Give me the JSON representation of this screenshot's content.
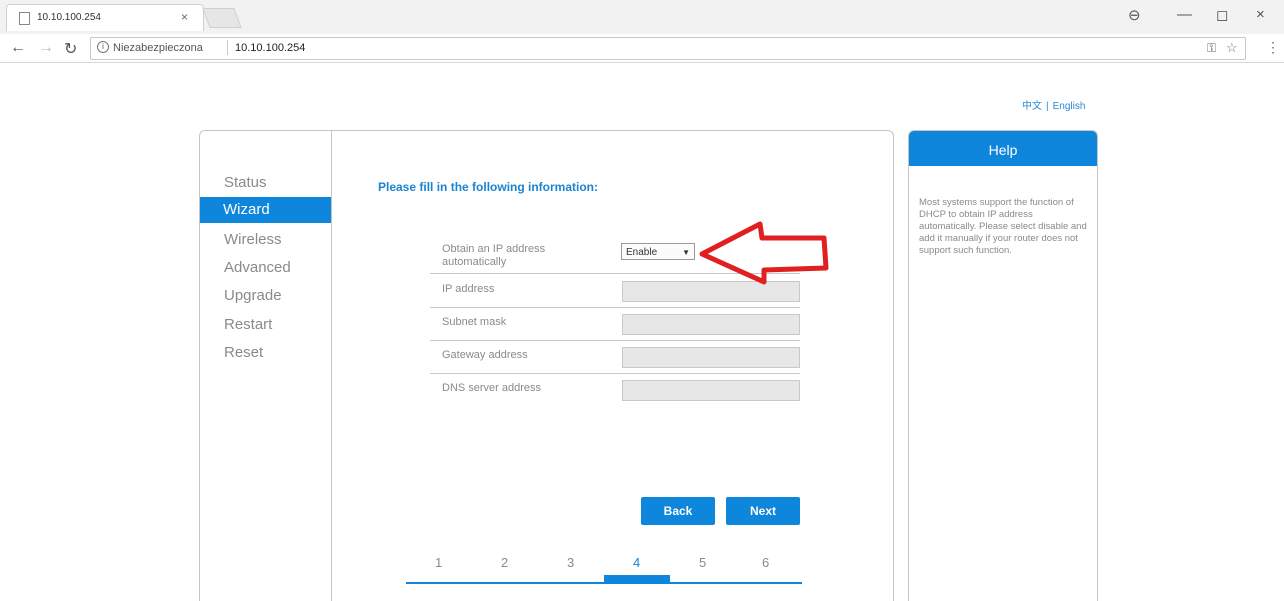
{
  "browser": {
    "tab_title": "10.10.100.254",
    "tab_close": "×",
    "security_label": "Niezabezpieczona",
    "url": "10.10.100.254",
    "window_controls": {
      "account": "⊖",
      "minimize": "—",
      "restore": "◻",
      "close": "×"
    }
  },
  "lang": {
    "chinese": "中文",
    "separator": "|",
    "english": "English"
  },
  "sidebar": {
    "items": [
      {
        "label": "Status"
      },
      {
        "label": "Wizard",
        "active": true
      },
      {
        "label": "Wireless"
      },
      {
        "label": "Advanced"
      },
      {
        "label": "Upgrade"
      },
      {
        "label": "Restart"
      },
      {
        "label": "Reset"
      }
    ]
  },
  "form": {
    "heading": "Please fill in the following information:",
    "obtain_ip_label": "Obtain an IP address automatically",
    "obtain_ip_value": "Enable",
    "ip_address_label": "IP address",
    "subnet_mask_label": "Subnet mask",
    "gateway_label": "Gateway address",
    "dns_label": "DNS server address",
    "back_label": "Back",
    "next_label": "Next"
  },
  "wizard_steps": {
    "steps": [
      "1",
      "2",
      "3",
      "4",
      "5",
      "6"
    ],
    "current": "4"
  },
  "help": {
    "title": "Help",
    "text": "Most systems support the function of DHCP to obtain IP address automatically. Please select disable and add it manually if your router does not support such function."
  },
  "colors": {
    "accent": "#0e86db",
    "annotation_arrow": "#e02020"
  }
}
